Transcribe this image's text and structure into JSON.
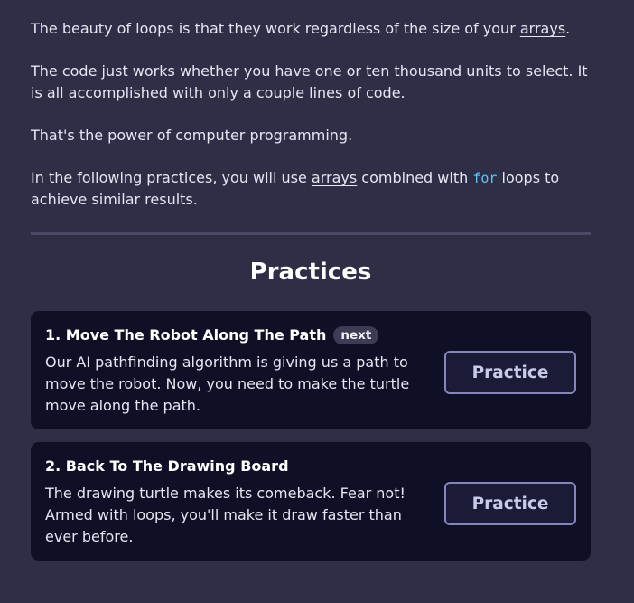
{
  "intro": {
    "p1": {
      "before": "The beauty of loops is that they work regardless of the size of your ",
      "link": "arrays",
      "after": "."
    },
    "p2": "The code just works whether you have one or ten thousand units to select. It is all accomplished with only a couple lines of code.",
    "p3": "That's the power of computer programming.",
    "p4": {
      "before": "In the following practices, you will use ",
      "link": "arrays",
      "middle": " combined with ",
      "code": "for",
      "after": " loops to achieve similar results."
    }
  },
  "practices": {
    "title": "Practices",
    "items": [
      {
        "title": "1. Move The Robot Along The Path",
        "badge": "next",
        "description": "Our AI pathfinding algorithm is giving us a path to move the robot. Now, you need to make the turtle move along the path.",
        "button": "Practice"
      },
      {
        "title": "2. Back To The Drawing Board",
        "description": "The drawing turtle makes its comeback. Fear not! Armed with loops, you'll make it draw faster than ever before.",
        "button": "Practice"
      }
    ]
  },
  "colors": {
    "background": "#2e2e46",
    "card_background": "#0f0f26",
    "code_accent": "#5fc4f7",
    "button_border": "#8585bb"
  }
}
